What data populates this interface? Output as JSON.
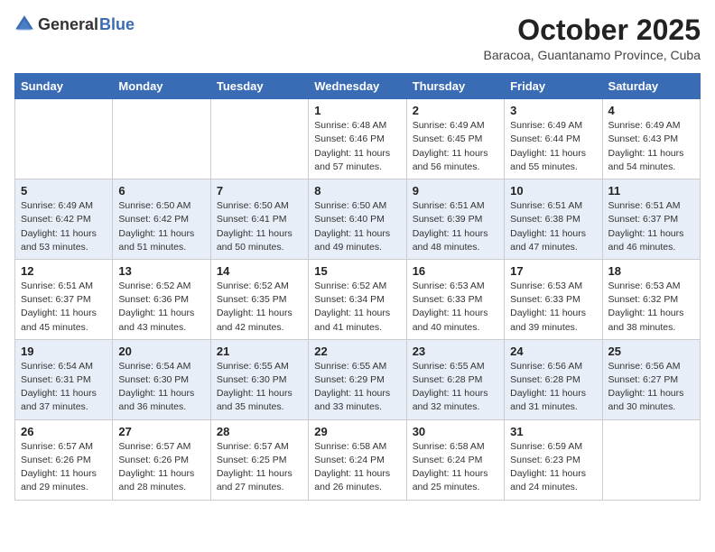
{
  "header": {
    "logo_general": "General",
    "logo_blue": "Blue",
    "month_title": "October 2025",
    "location": "Baracoa, Guantanamo Province, Cuba"
  },
  "weekdays": [
    "Sunday",
    "Monday",
    "Tuesday",
    "Wednesday",
    "Thursday",
    "Friday",
    "Saturday"
  ],
  "weeks": [
    [
      {
        "day": "",
        "info": ""
      },
      {
        "day": "",
        "info": ""
      },
      {
        "day": "",
        "info": ""
      },
      {
        "day": "1",
        "info": "Sunrise: 6:48 AM\nSunset: 6:46 PM\nDaylight: 11 hours and 57 minutes."
      },
      {
        "day": "2",
        "info": "Sunrise: 6:49 AM\nSunset: 6:45 PM\nDaylight: 11 hours and 56 minutes."
      },
      {
        "day": "3",
        "info": "Sunrise: 6:49 AM\nSunset: 6:44 PM\nDaylight: 11 hours and 55 minutes."
      },
      {
        "day": "4",
        "info": "Sunrise: 6:49 AM\nSunset: 6:43 PM\nDaylight: 11 hours and 54 minutes."
      }
    ],
    [
      {
        "day": "5",
        "info": "Sunrise: 6:49 AM\nSunset: 6:42 PM\nDaylight: 11 hours and 53 minutes."
      },
      {
        "day": "6",
        "info": "Sunrise: 6:50 AM\nSunset: 6:42 PM\nDaylight: 11 hours and 51 minutes."
      },
      {
        "day": "7",
        "info": "Sunrise: 6:50 AM\nSunset: 6:41 PM\nDaylight: 11 hours and 50 minutes."
      },
      {
        "day": "8",
        "info": "Sunrise: 6:50 AM\nSunset: 6:40 PM\nDaylight: 11 hours and 49 minutes."
      },
      {
        "day": "9",
        "info": "Sunrise: 6:51 AM\nSunset: 6:39 PM\nDaylight: 11 hours and 48 minutes."
      },
      {
        "day": "10",
        "info": "Sunrise: 6:51 AM\nSunset: 6:38 PM\nDaylight: 11 hours and 47 minutes."
      },
      {
        "day": "11",
        "info": "Sunrise: 6:51 AM\nSunset: 6:37 PM\nDaylight: 11 hours and 46 minutes."
      }
    ],
    [
      {
        "day": "12",
        "info": "Sunrise: 6:51 AM\nSunset: 6:37 PM\nDaylight: 11 hours and 45 minutes."
      },
      {
        "day": "13",
        "info": "Sunrise: 6:52 AM\nSunset: 6:36 PM\nDaylight: 11 hours and 43 minutes."
      },
      {
        "day": "14",
        "info": "Sunrise: 6:52 AM\nSunset: 6:35 PM\nDaylight: 11 hours and 42 minutes."
      },
      {
        "day": "15",
        "info": "Sunrise: 6:52 AM\nSunset: 6:34 PM\nDaylight: 11 hours and 41 minutes."
      },
      {
        "day": "16",
        "info": "Sunrise: 6:53 AM\nSunset: 6:33 PM\nDaylight: 11 hours and 40 minutes."
      },
      {
        "day": "17",
        "info": "Sunrise: 6:53 AM\nSunset: 6:33 PM\nDaylight: 11 hours and 39 minutes."
      },
      {
        "day": "18",
        "info": "Sunrise: 6:53 AM\nSunset: 6:32 PM\nDaylight: 11 hours and 38 minutes."
      }
    ],
    [
      {
        "day": "19",
        "info": "Sunrise: 6:54 AM\nSunset: 6:31 PM\nDaylight: 11 hours and 37 minutes."
      },
      {
        "day": "20",
        "info": "Sunrise: 6:54 AM\nSunset: 6:30 PM\nDaylight: 11 hours and 36 minutes."
      },
      {
        "day": "21",
        "info": "Sunrise: 6:55 AM\nSunset: 6:30 PM\nDaylight: 11 hours and 35 minutes."
      },
      {
        "day": "22",
        "info": "Sunrise: 6:55 AM\nSunset: 6:29 PM\nDaylight: 11 hours and 33 minutes."
      },
      {
        "day": "23",
        "info": "Sunrise: 6:55 AM\nSunset: 6:28 PM\nDaylight: 11 hours and 32 minutes."
      },
      {
        "day": "24",
        "info": "Sunrise: 6:56 AM\nSunset: 6:28 PM\nDaylight: 11 hours and 31 minutes."
      },
      {
        "day": "25",
        "info": "Sunrise: 6:56 AM\nSunset: 6:27 PM\nDaylight: 11 hours and 30 minutes."
      }
    ],
    [
      {
        "day": "26",
        "info": "Sunrise: 6:57 AM\nSunset: 6:26 PM\nDaylight: 11 hours and 29 minutes."
      },
      {
        "day": "27",
        "info": "Sunrise: 6:57 AM\nSunset: 6:26 PM\nDaylight: 11 hours and 28 minutes."
      },
      {
        "day": "28",
        "info": "Sunrise: 6:57 AM\nSunset: 6:25 PM\nDaylight: 11 hours and 27 minutes."
      },
      {
        "day": "29",
        "info": "Sunrise: 6:58 AM\nSunset: 6:24 PM\nDaylight: 11 hours and 26 minutes."
      },
      {
        "day": "30",
        "info": "Sunrise: 6:58 AM\nSunset: 6:24 PM\nDaylight: 11 hours and 25 minutes."
      },
      {
        "day": "31",
        "info": "Sunrise: 6:59 AM\nSunset: 6:23 PM\nDaylight: 11 hours and 24 minutes."
      },
      {
        "day": "",
        "info": ""
      }
    ]
  ]
}
